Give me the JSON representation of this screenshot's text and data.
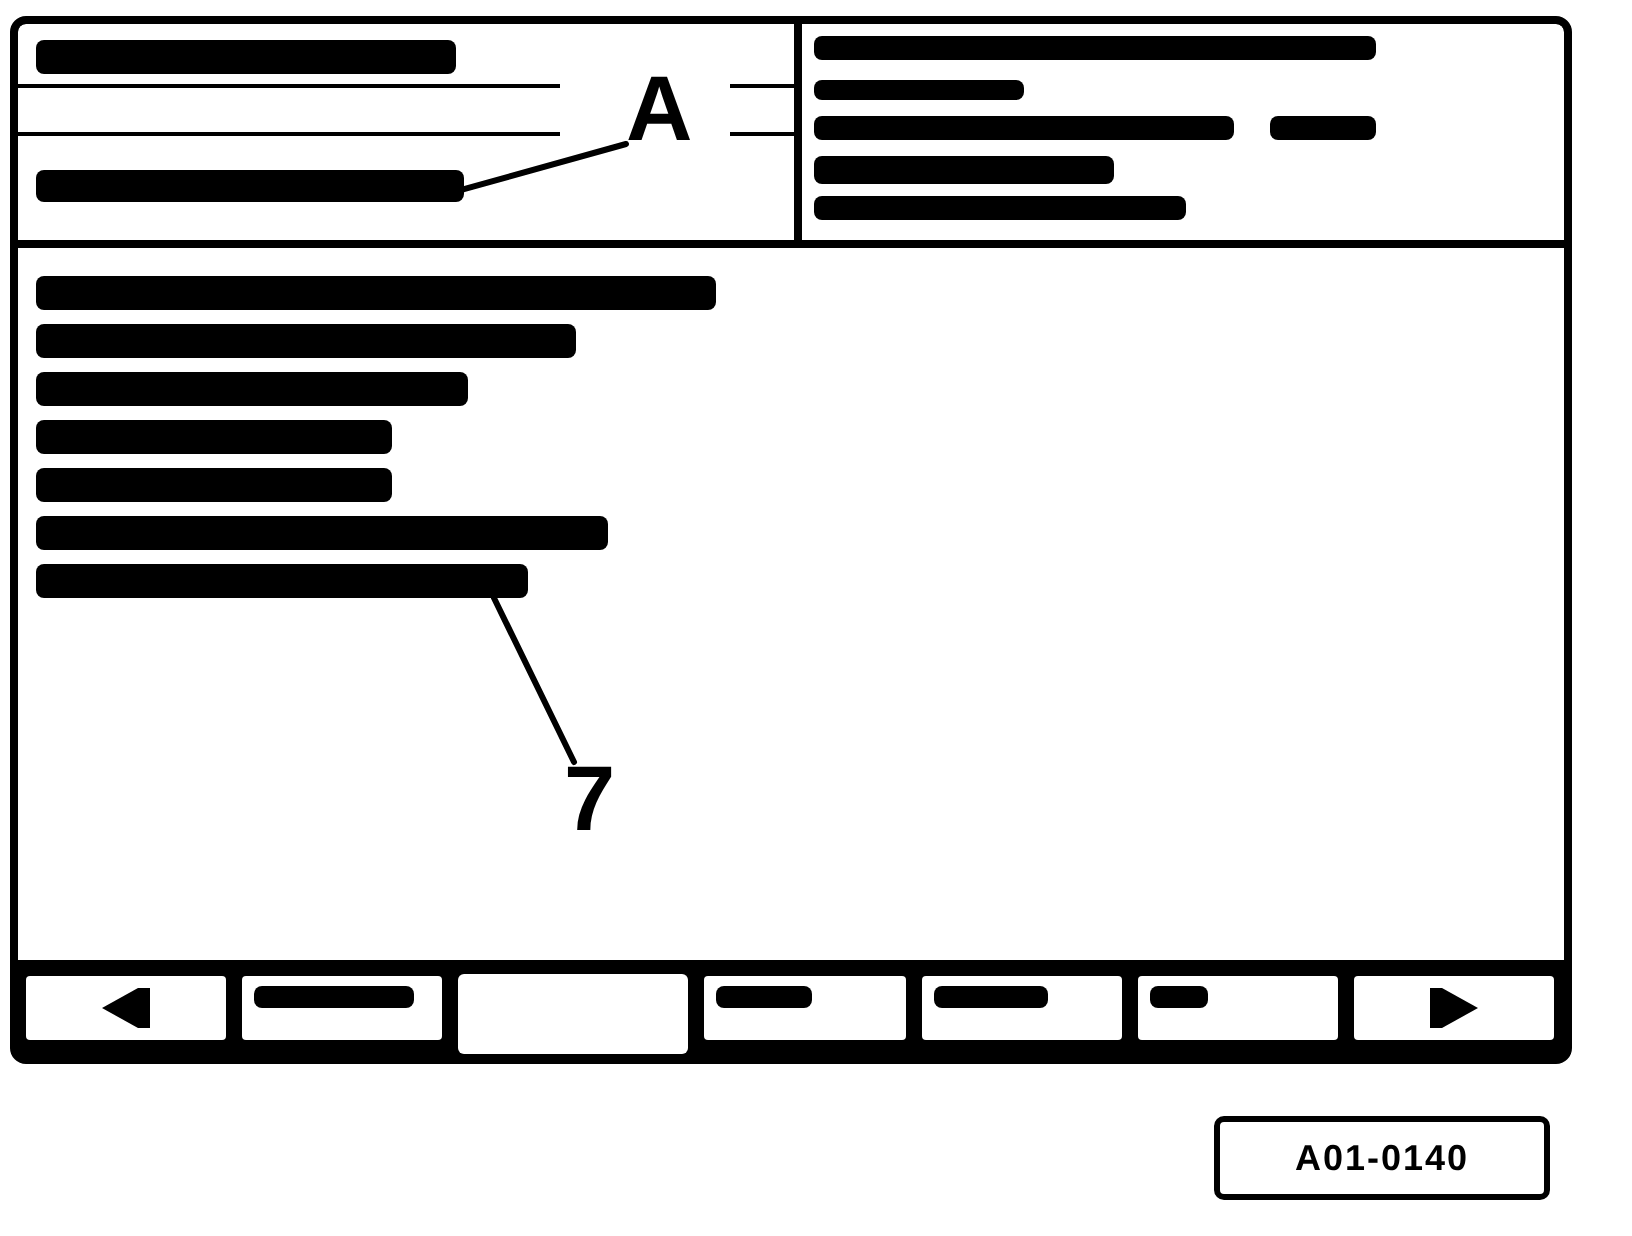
{
  "screen": {
    "header_left": {
      "rows": [
        {
          "kind": "bar"
        },
        {
          "kind": "ruled-blank"
        },
        {
          "kind": "bar",
          "callout": "A"
        }
      ]
    },
    "header_right": {
      "rows": [
        {
          "kind": "bar"
        },
        {
          "kind": "bar"
        },
        {
          "kind": "bar-pair"
        },
        {
          "kind": "bar"
        },
        {
          "kind": "bar"
        }
      ]
    },
    "body": {
      "rows": [
        {
          "kind": "bar"
        },
        {
          "kind": "bar"
        },
        {
          "kind": "bar"
        },
        {
          "kind": "bar"
        },
        {
          "kind": "bar"
        },
        {
          "kind": "bar"
        },
        {
          "kind": "bar",
          "callout": "7"
        }
      ]
    },
    "softkeys": [
      {
        "kind": "arrow-left"
      },
      {
        "kind": "bar"
      },
      {
        "kind": "blank"
      },
      {
        "kind": "bar"
      },
      {
        "kind": "bar"
      },
      {
        "kind": "bar"
      },
      {
        "kind": "arrow-right"
      }
    ]
  },
  "figure_id": "A01-0140"
}
